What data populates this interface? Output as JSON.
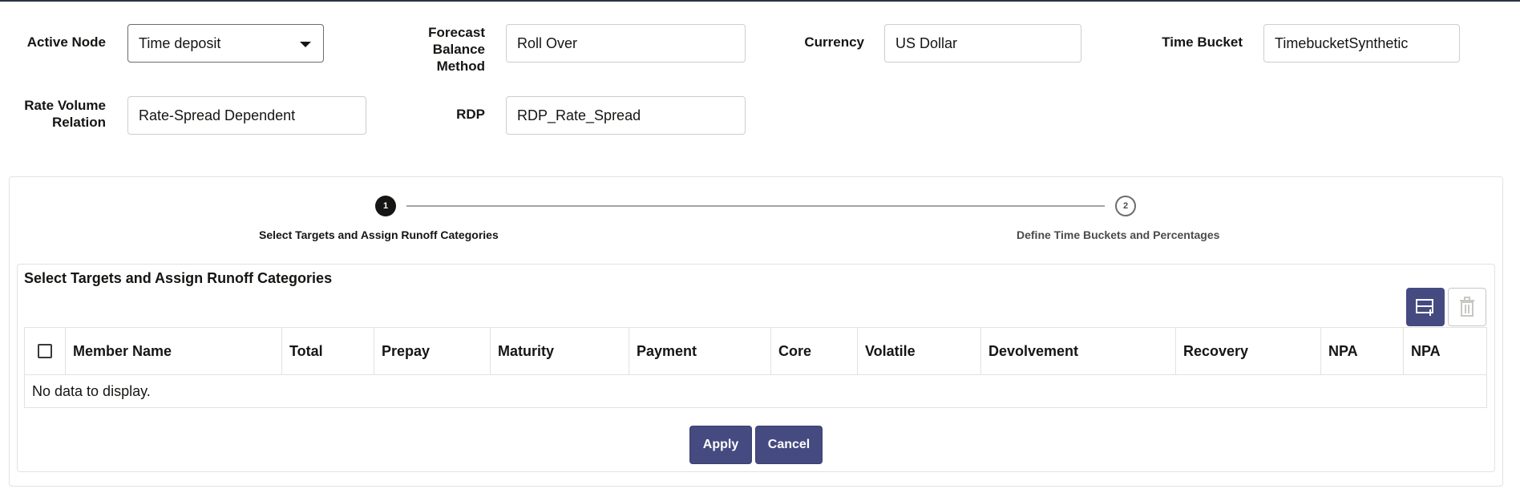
{
  "form": {
    "active_node": {
      "label": "Active Node",
      "value": "Time deposit"
    },
    "forecast_balance_method": {
      "label_line1": "Forecast",
      "label_line2": "Balance",
      "label_line3": "Method",
      "value": "Roll Over"
    },
    "currency": {
      "label": "Currency",
      "value": "US Dollar"
    },
    "time_bucket": {
      "label": "Time Bucket",
      "value": "TimebucketSynthetic"
    },
    "rate_volume_relation": {
      "label_line1": "Rate Volume",
      "label_line2": "Relation",
      "value": "Rate-Spread Dependent"
    },
    "rdp": {
      "label": "RDP",
      "value": "RDP_Rate_Spread"
    }
  },
  "steps": [
    {
      "number": "1",
      "label": "Select Targets and Assign Runoff Categories",
      "state": "active"
    },
    {
      "number": "2",
      "label": "Define Time Buckets and Percentages",
      "state": "inactive"
    }
  ],
  "section": {
    "title": "Select Targets and Assign Runoff Categories",
    "add_icon": "add-row-icon",
    "delete_icon": "delete-icon"
  },
  "table": {
    "columns": [
      "Member Name",
      "Total",
      "Prepay",
      "Maturity",
      "Payment",
      "Core",
      "Volatile",
      "Devolvement",
      "Recovery",
      "NPA",
      "NPA"
    ],
    "empty_message": "No data to display."
  },
  "actions": {
    "apply": "Apply",
    "cancel": "Cancel"
  },
  "colors": {
    "primary": "#454b80",
    "step_active": "#161513",
    "border": "#e4e2df"
  }
}
